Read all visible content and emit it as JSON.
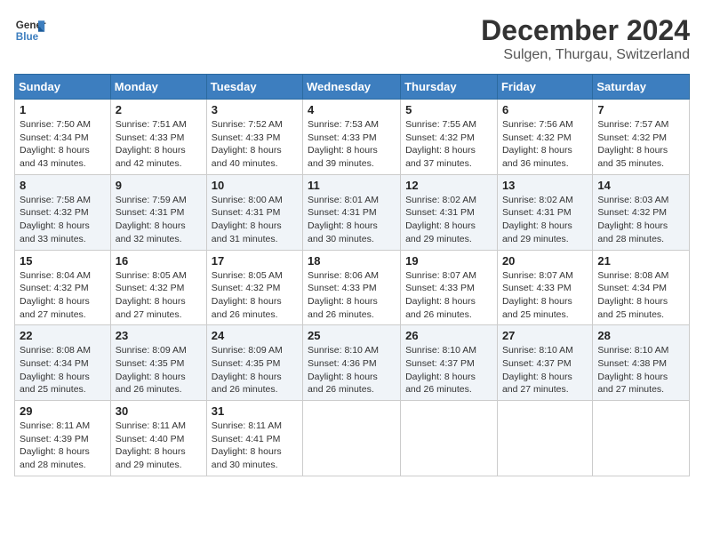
{
  "header": {
    "logo_line1": "General",
    "logo_line2": "Blue",
    "month": "December 2024",
    "location": "Sulgen, Thurgau, Switzerland"
  },
  "weekdays": [
    "Sunday",
    "Monday",
    "Tuesday",
    "Wednesday",
    "Thursday",
    "Friday",
    "Saturday"
  ],
  "weeks": [
    [
      {
        "day": "1",
        "sunrise": "Sunrise: 7:50 AM",
        "sunset": "Sunset: 4:34 PM",
        "daylight": "Daylight: 8 hours and 43 minutes."
      },
      {
        "day": "2",
        "sunrise": "Sunrise: 7:51 AM",
        "sunset": "Sunset: 4:33 PM",
        "daylight": "Daylight: 8 hours and 42 minutes."
      },
      {
        "day": "3",
        "sunrise": "Sunrise: 7:52 AM",
        "sunset": "Sunset: 4:33 PM",
        "daylight": "Daylight: 8 hours and 40 minutes."
      },
      {
        "day": "4",
        "sunrise": "Sunrise: 7:53 AM",
        "sunset": "Sunset: 4:33 PM",
        "daylight": "Daylight: 8 hours and 39 minutes."
      },
      {
        "day": "5",
        "sunrise": "Sunrise: 7:55 AM",
        "sunset": "Sunset: 4:32 PM",
        "daylight": "Daylight: 8 hours and 37 minutes."
      },
      {
        "day": "6",
        "sunrise": "Sunrise: 7:56 AM",
        "sunset": "Sunset: 4:32 PM",
        "daylight": "Daylight: 8 hours and 36 minutes."
      },
      {
        "day": "7",
        "sunrise": "Sunrise: 7:57 AM",
        "sunset": "Sunset: 4:32 PM",
        "daylight": "Daylight: 8 hours and 35 minutes."
      }
    ],
    [
      {
        "day": "8",
        "sunrise": "Sunrise: 7:58 AM",
        "sunset": "Sunset: 4:32 PM",
        "daylight": "Daylight: 8 hours and 33 minutes."
      },
      {
        "day": "9",
        "sunrise": "Sunrise: 7:59 AM",
        "sunset": "Sunset: 4:31 PM",
        "daylight": "Daylight: 8 hours and 32 minutes."
      },
      {
        "day": "10",
        "sunrise": "Sunrise: 8:00 AM",
        "sunset": "Sunset: 4:31 PM",
        "daylight": "Daylight: 8 hours and 31 minutes."
      },
      {
        "day": "11",
        "sunrise": "Sunrise: 8:01 AM",
        "sunset": "Sunset: 4:31 PM",
        "daylight": "Daylight: 8 hours and 30 minutes."
      },
      {
        "day": "12",
        "sunrise": "Sunrise: 8:02 AM",
        "sunset": "Sunset: 4:31 PM",
        "daylight": "Daylight: 8 hours and 29 minutes."
      },
      {
        "day": "13",
        "sunrise": "Sunrise: 8:02 AM",
        "sunset": "Sunset: 4:31 PM",
        "daylight": "Daylight: 8 hours and 29 minutes."
      },
      {
        "day": "14",
        "sunrise": "Sunrise: 8:03 AM",
        "sunset": "Sunset: 4:32 PM",
        "daylight": "Daylight: 8 hours and 28 minutes."
      }
    ],
    [
      {
        "day": "15",
        "sunrise": "Sunrise: 8:04 AM",
        "sunset": "Sunset: 4:32 PM",
        "daylight": "Daylight: 8 hours and 27 minutes."
      },
      {
        "day": "16",
        "sunrise": "Sunrise: 8:05 AM",
        "sunset": "Sunset: 4:32 PM",
        "daylight": "Daylight: 8 hours and 27 minutes."
      },
      {
        "day": "17",
        "sunrise": "Sunrise: 8:05 AM",
        "sunset": "Sunset: 4:32 PM",
        "daylight": "Daylight: 8 hours and 26 minutes."
      },
      {
        "day": "18",
        "sunrise": "Sunrise: 8:06 AM",
        "sunset": "Sunset: 4:33 PM",
        "daylight": "Daylight: 8 hours and 26 minutes."
      },
      {
        "day": "19",
        "sunrise": "Sunrise: 8:07 AM",
        "sunset": "Sunset: 4:33 PM",
        "daylight": "Daylight: 8 hours and 26 minutes."
      },
      {
        "day": "20",
        "sunrise": "Sunrise: 8:07 AM",
        "sunset": "Sunset: 4:33 PM",
        "daylight": "Daylight: 8 hours and 25 minutes."
      },
      {
        "day": "21",
        "sunrise": "Sunrise: 8:08 AM",
        "sunset": "Sunset: 4:34 PM",
        "daylight": "Daylight: 8 hours and 25 minutes."
      }
    ],
    [
      {
        "day": "22",
        "sunrise": "Sunrise: 8:08 AM",
        "sunset": "Sunset: 4:34 PM",
        "daylight": "Daylight: 8 hours and 25 minutes."
      },
      {
        "day": "23",
        "sunrise": "Sunrise: 8:09 AM",
        "sunset": "Sunset: 4:35 PM",
        "daylight": "Daylight: 8 hours and 26 minutes."
      },
      {
        "day": "24",
        "sunrise": "Sunrise: 8:09 AM",
        "sunset": "Sunset: 4:35 PM",
        "daylight": "Daylight: 8 hours and 26 minutes."
      },
      {
        "day": "25",
        "sunrise": "Sunrise: 8:10 AM",
        "sunset": "Sunset: 4:36 PM",
        "daylight": "Daylight: 8 hours and 26 minutes."
      },
      {
        "day": "26",
        "sunrise": "Sunrise: 8:10 AM",
        "sunset": "Sunset: 4:37 PM",
        "daylight": "Daylight: 8 hours and 26 minutes."
      },
      {
        "day": "27",
        "sunrise": "Sunrise: 8:10 AM",
        "sunset": "Sunset: 4:37 PM",
        "daylight": "Daylight: 8 hours and 27 minutes."
      },
      {
        "day": "28",
        "sunrise": "Sunrise: 8:10 AM",
        "sunset": "Sunset: 4:38 PM",
        "daylight": "Daylight: 8 hours and 27 minutes."
      }
    ],
    [
      {
        "day": "29",
        "sunrise": "Sunrise: 8:11 AM",
        "sunset": "Sunset: 4:39 PM",
        "daylight": "Daylight: 8 hours and 28 minutes."
      },
      {
        "day": "30",
        "sunrise": "Sunrise: 8:11 AM",
        "sunset": "Sunset: 4:40 PM",
        "daylight": "Daylight: 8 hours and 29 minutes."
      },
      {
        "day": "31",
        "sunrise": "Sunrise: 8:11 AM",
        "sunset": "Sunset: 4:41 PM",
        "daylight": "Daylight: 8 hours and 30 minutes."
      },
      null,
      null,
      null,
      null
    ]
  ]
}
